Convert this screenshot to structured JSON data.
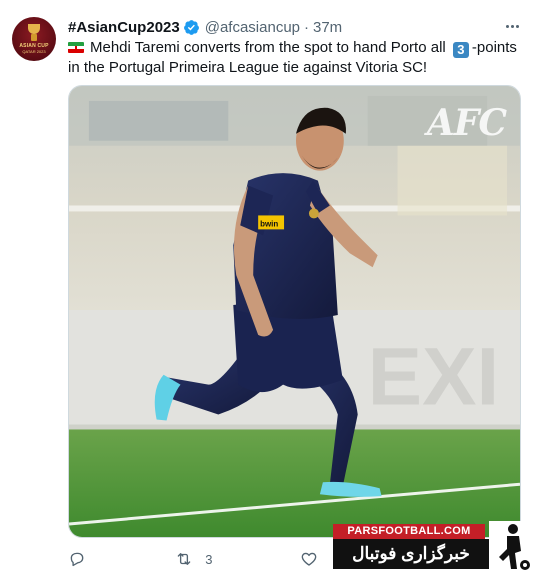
{
  "tweet": {
    "display_name": "#AsianCup2023",
    "handle": "@afcasiancup",
    "separator": "·",
    "time": "37m",
    "avatar_label": "ASIAN CUP",
    "avatar_sublabel": "QATAR 2023",
    "text_part1": "Mehdi Taremi converts from the spot to hand Porto all ",
    "keycap_number": "3",
    "text_part2": "-points in the Portugal Primeira League tie against Vitoria SC!",
    "flag_icon": "iran-flag-icon",
    "verified_icon": "verified-badge-icon",
    "more_icon": "more-icon"
  },
  "media": {
    "logo_text": "AFC",
    "shirt_text": "bwin",
    "board_text": "EXI"
  },
  "actions": {
    "reply_icon": "reply-icon",
    "retweet_icon": "retweet-icon",
    "retweet_count": "3",
    "like_icon": "like-icon"
  },
  "watermark": {
    "site": "PARSFOOTBALL.COM",
    "persian": "خبرگزاری فوتبال ایران"
  },
  "colors": {
    "accent": "#1d9bf0",
    "secondary_text": "#536471",
    "keycap": "#3b88c3",
    "watermark_red": "#c41f27",
    "pitch_green": "#3f8a2e",
    "kit_navy": "#1a2350"
  }
}
